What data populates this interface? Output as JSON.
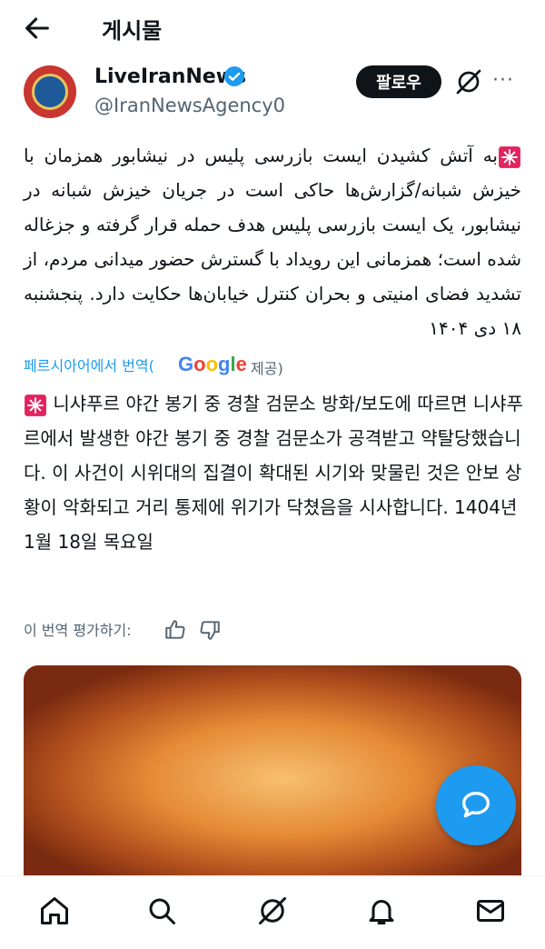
{
  "header": {
    "title": "게시물",
    "back_icon": "arrow-left-icon"
  },
  "author": {
    "name": "LiveIranNews",
    "handle": "@IranNewsAgency0",
    "follow_label": "팔로우",
    "more_label": "···"
  },
  "post": {
    "persian": "به آتش کشیدن ایست بازرسی پلیس در نیشابور همزمان با خیزش شبانه/گزارش‌ها حاکی است در جریان خیزش شبانه در نیشابور، یک ایست بازرسی پلیس هدف حمله قرار گرفته و جزغاله شده است؛ همزمانی این رویداد با گسترش حضور میدانی مردم، از تشدید فضای امنیتی و بحران کنترل خیابان‌ها حکایت دارد. پنجشنبه ۱۸ دی ۱۴۰۴",
    "translated_from": "페르시아어에서 번역(",
    "google": "Google",
    "provided": "제공)",
    "korean": "니샤푸르 야간 봉기 중 경찰 검문소 방화/보도에 따르면 니샤푸르에서 발생한 야간 봉기 중 경찰 검문소가 공격받고 약탈당했습니다. 이 사건이 시위대의 집결이 확대된 시기와 맞물린 것은 안보 상황이 악화되고 거리 통제에 위기가 닥쳤음을 시사합니다. 1404년 1월 18일 목요일",
    "rate_label": "이 번역 평가하기:"
  },
  "colors": {
    "accent": "#1d9bf0",
    "alarm": "#e0245e",
    "text": "#0f1419",
    "muted": "#536471"
  },
  "nav": [
    "home-icon",
    "search-icon",
    "grok-icon",
    "bell-icon",
    "mail-icon"
  ]
}
